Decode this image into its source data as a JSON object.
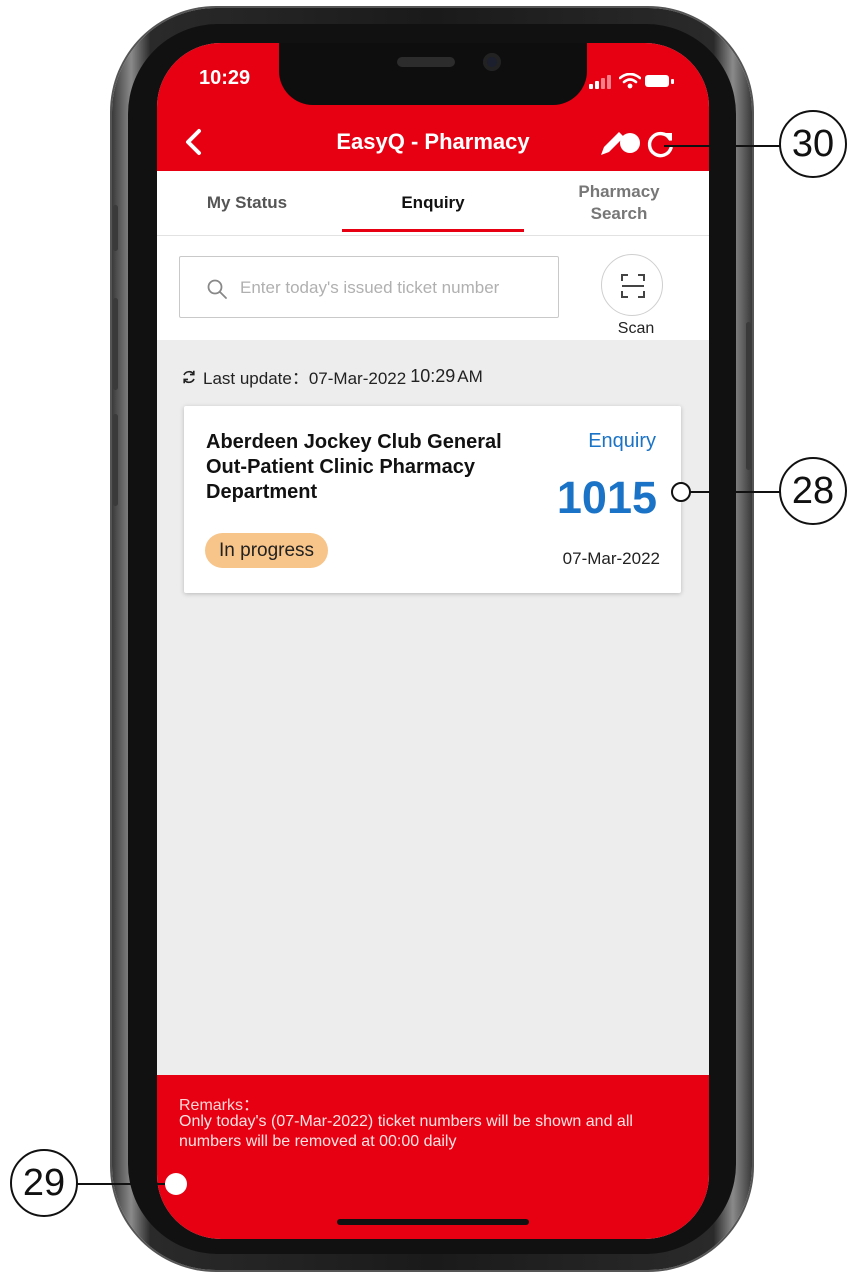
{
  "status_bar": {
    "time": "10:29"
  },
  "header": {
    "title": "EasyQ - Pharmacy"
  },
  "tabs": [
    {
      "label": "My Status"
    },
    {
      "label": "Enquiry"
    },
    {
      "label": "Pharmacy Search"
    }
  ],
  "search": {
    "placeholder": "Enter today's issued ticket number",
    "value": ""
  },
  "scan": {
    "label": "Scan"
  },
  "last_update": {
    "label": "Last update：07-Mar-2022",
    "time": "10:29",
    "ampm": "AM"
  },
  "card": {
    "clinic_name": "Aberdeen Jockey Club General Out-Patient Clinic Pharmacy Department",
    "status": "In progress",
    "type_label": "Enquiry",
    "ticket_number": "1015",
    "date": "07-Mar-2022"
  },
  "remarks": {
    "title": "Remarks：",
    "text": "Only today's (07-Mar-2022) ticket numbers will be shown and all numbers will be removed at 00:00 daily"
  },
  "callouts": {
    "c28": "28",
    "c29": "29",
    "c30": "30"
  },
  "colors": {
    "brand_red": "#e60012",
    "accent_blue": "#1a73c6",
    "badge_orange": "#f7c489"
  },
  "icons": [
    "back-arrow-icon",
    "edit-icon",
    "refresh-icon",
    "search-icon",
    "scan-icon",
    "sync-icon"
  ]
}
